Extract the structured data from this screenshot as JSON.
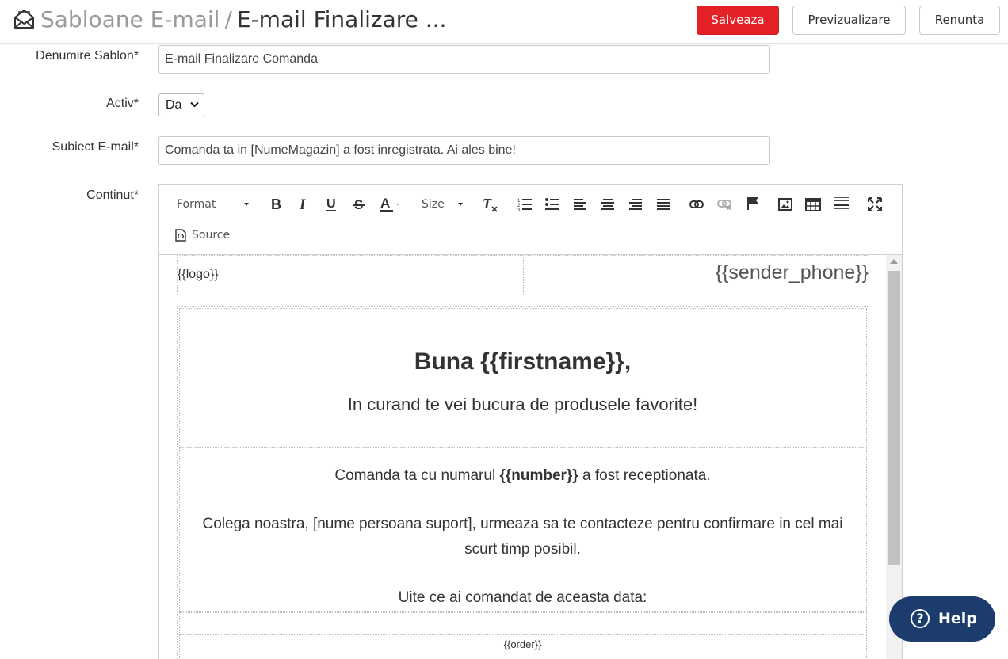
{
  "header": {
    "section": "Sabloane E-mail",
    "separator": "/",
    "current": "E-mail Finalizare ...",
    "save_label": "Salveaza",
    "preview_label": "Previzualizare",
    "cancel_label": "Renunta"
  },
  "form": {
    "name_label": "Denumire Sablon*",
    "name_value": "E-mail Finalizare Comanda",
    "active_label": "Activ*",
    "active_value": "Da",
    "subject_label": "Subiect E-mail*",
    "subject_value": "Comanda ta in [NumeMagazin] a fost inregistrata. Ai ales bine!",
    "content_label": "Continut*"
  },
  "toolbar": {
    "format_label": "Format",
    "size_label": "Size",
    "source_label": "Source"
  },
  "email": {
    "logo": "{{logo}}",
    "sender_phone": "{{sender_phone}}",
    "greeting": "Buna {{firstname}},",
    "tagline": "In curand te vei bucura de produsele favorite!",
    "order_prefix": "Comanda ta cu numarul ",
    "order_number": "{{number}}",
    "order_suffix": " a fost receptionata.",
    "support_line1": "Colega noastra, [nume persoana suport], urmeaza sa te contacteze pentru confirmare in cel mai",
    "support_line2": "scurt timp posibil.",
    "ordered_title": "Uite ce ai comandat de aceasta data:",
    "order_placeholder": "{{order}}"
  },
  "help": {
    "label": "Help"
  }
}
